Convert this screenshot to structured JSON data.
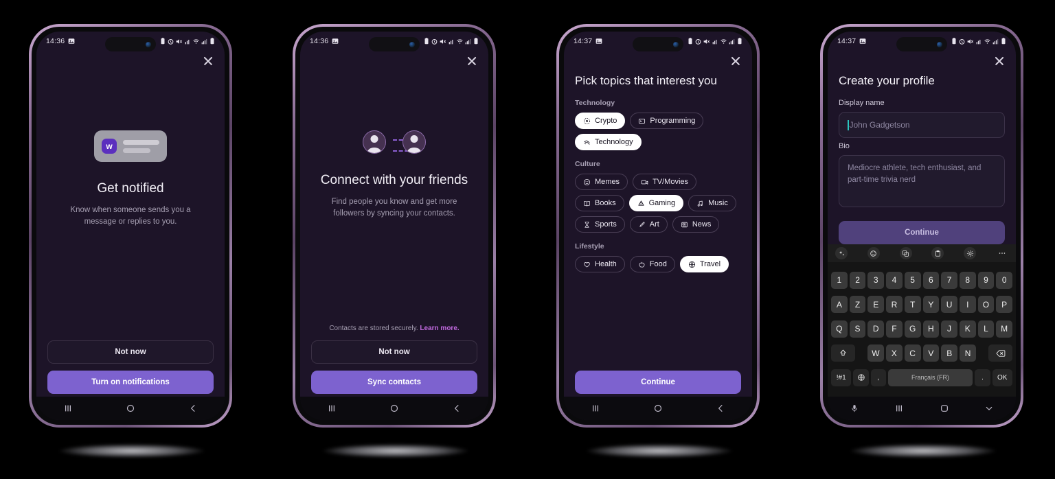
{
  "screens": [
    {
      "status": {
        "time": "14:36",
        "icons": [
          "image-icon",
          "battery-saver-icon",
          "alarm-icon",
          "mute-icon",
          "signal-alt-icon",
          "wifi-icon",
          "signal-icon",
          "battery-icon"
        ]
      },
      "close_label": "close",
      "title": "Get notified",
      "subtitle": "Know when someone sends you a message or replies to you.",
      "illustration": "notification-card",
      "badge_letter": "w",
      "secondary_button": "Not now",
      "primary_button": "Turn on notifications",
      "nav": [
        "recents",
        "home",
        "back"
      ]
    },
    {
      "status": {
        "time": "14:36"
      },
      "title": "Connect with your friends",
      "subtitle": "Find people you know and get more followers by syncing your contacts.",
      "illustration": "two-avatars",
      "note_text": "Contacts are stored securely.",
      "note_link": "Learn more.",
      "secondary_button": "Not now",
      "primary_button": "Sync contacts",
      "nav": [
        "recents",
        "home",
        "back"
      ]
    },
    {
      "status": {
        "time": "14:37"
      },
      "title": "Pick topics that interest you",
      "categories": [
        {
          "label": "Technology",
          "chips": [
            {
              "label": "Crypto",
              "icon": "crypto-icon",
              "selected": true
            },
            {
              "label": "Programming",
              "icon": "programming-icon",
              "selected": false
            },
            {
              "label": "Technology",
              "icon": "technology-icon",
              "selected": true
            }
          ]
        },
        {
          "label": "Culture",
          "chips": [
            {
              "label": "Memes",
              "icon": "smiley-icon",
              "selected": false
            },
            {
              "label": "TV/Movies",
              "icon": "video-icon",
              "selected": false
            },
            {
              "label": "Books",
              "icon": "book-icon",
              "selected": false
            },
            {
              "label": "Gaming",
              "icon": "gaming-icon",
              "selected": true
            },
            {
              "label": "Music",
              "icon": "music-icon",
              "selected": false
            },
            {
              "label": "Sports",
              "icon": "sports-icon",
              "selected": false
            },
            {
              "label": "Art",
              "icon": "brush-icon",
              "selected": false
            },
            {
              "label": "News",
              "icon": "news-icon",
              "selected": false
            }
          ]
        },
        {
          "label": "Lifestyle",
          "chips": [
            {
              "label": "Health",
              "icon": "heart-icon",
              "selected": false
            },
            {
              "label": "Food",
              "icon": "apple-icon",
              "selected": false
            },
            {
              "label": "Travel",
              "icon": "globe-icon",
              "selected": true
            }
          ]
        }
      ],
      "primary_button": "Continue",
      "nav": [
        "recents",
        "home",
        "back"
      ]
    },
    {
      "status": {
        "time": "14:37"
      },
      "title": "Create your profile",
      "display_name_label": "Display name",
      "display_name_value": "",
      "display_name_placeholder": "John Gadgetson",
      "bio_label": "Bio",
      "bio_value": "",
      "bio_placeholder": "Mediocre athlete, tech enthusiast, and part-time trivia nerd",
      "primary_button": "Continue",
      "keyboard": {
        "toolbar": [
          "ai-sparkle-icon",
          "emoji-icon",
          "sticker-translate-icon",
          "clipboard-icon",
          "gear-icon",
          "more-icon"
        ],
        "rows": [
          [
            "1",
            "2",
            "3",
            "4",
            "5",
            "6",
            "7",
            "8",
            "9",
            "0"
          ],
          [
            "A",
            "Z",
            "E",
            "R",
            "T",
            "Y",
            "U",
            "I",
            "O",
            "P"
          ],
          [
            "Q",
            "S",
            "D",
            "F",
            "G",
            "H",
            "J",
            "K",
            "L",
            "M"
          ],
          [
            "W",
            "X",
            "C",
            "V",
            "B",
            "N"
          ]
        ],
        "shift_label": "shift-icon",
        "backspace_label": "backspace-icon",
        "symbols_label": "!#1",
        "language_label": "globe-icon",
        "comma_label": ",",
        "space_label": "Français (FR)",
        "period_label": ".",
        "enter_label": "OK"
      },
      "nav": [
        "mic",
        "recents",
        "home",
        "hide-keyboard"
      ]
    }
  ],
  "colors": {
    "accent": "#7d62cf",
    "screen_bg": "#1d1428",
    "chip_selected_bg": "#ffffff",
    "link": "#c26ae0",
    "caret": "#2ac6c0"
  }
}
